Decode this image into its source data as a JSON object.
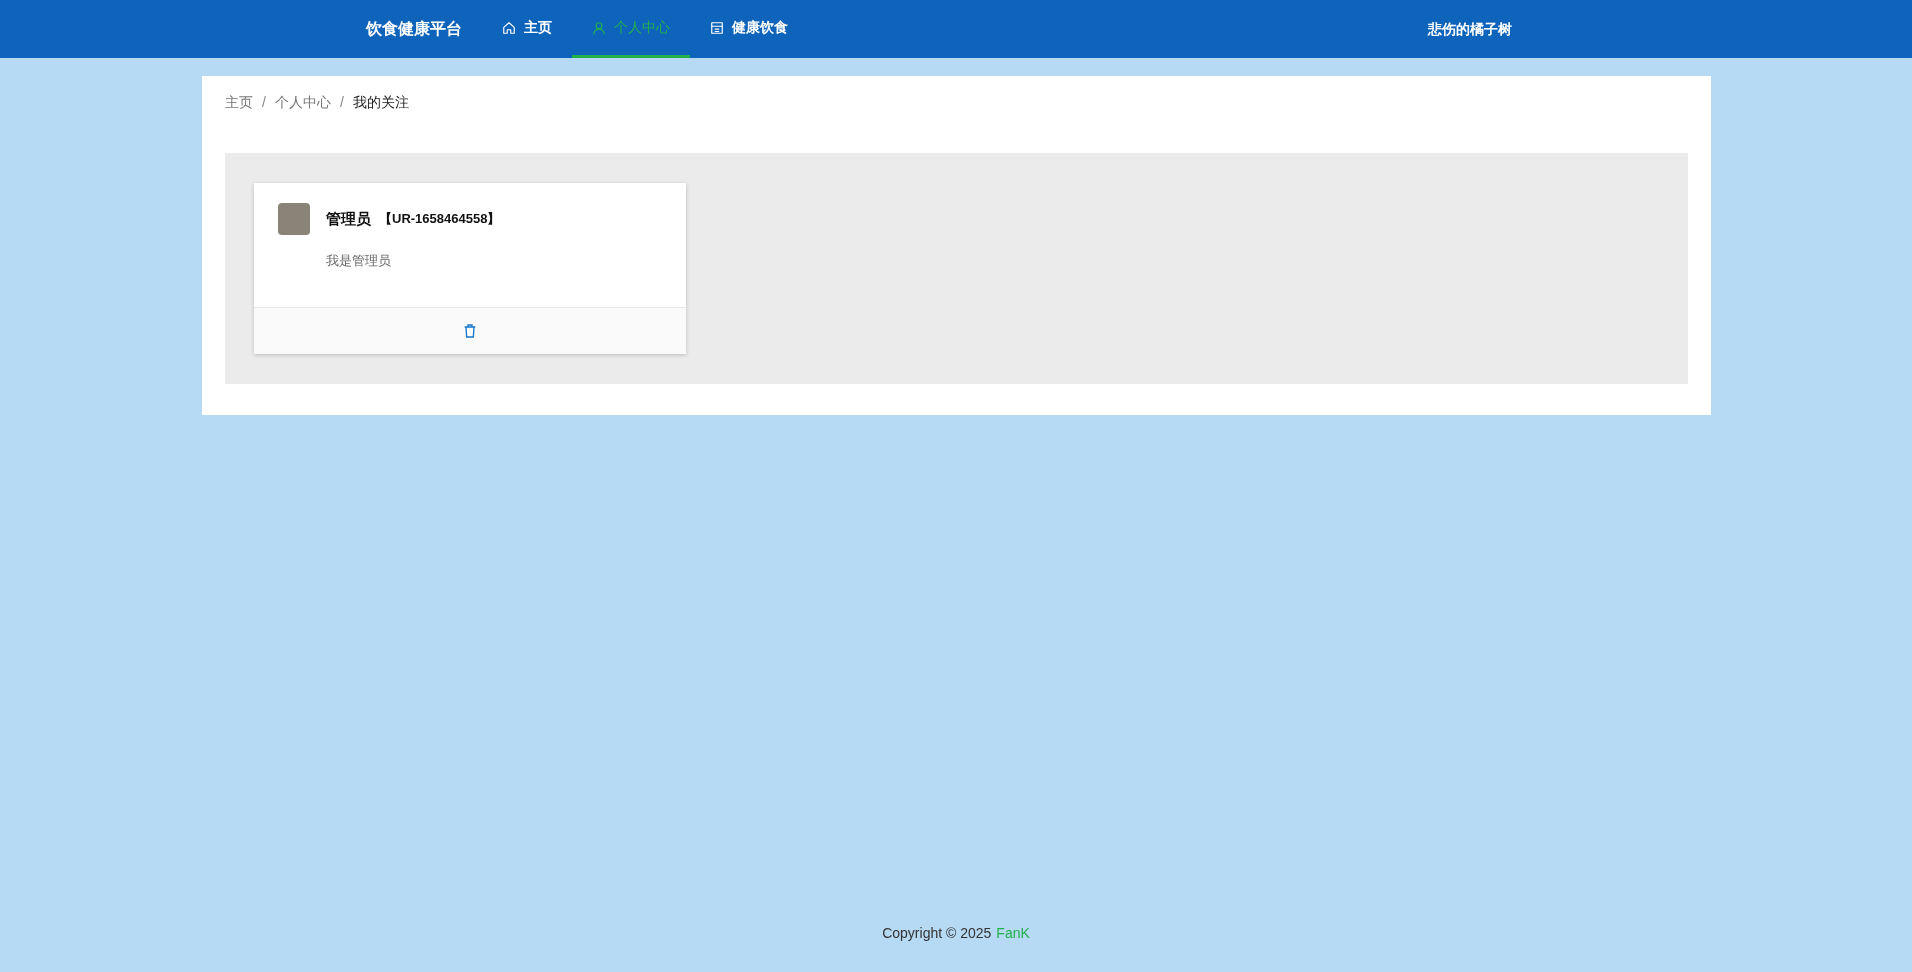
{
  "navbar": {
    "brand": "饮食健康平台",
    "items": [
      {
        "label": "主页",
        "selected": false
      },
      {
        "label": "个人中心",
        "selected": true
      },
      {
        "label": "健康饮食",
        "selected": false
      }
    ],
    "user": "悲伤的橘子树"
  },
  "breadcrumb": {
    "separator": "/",
    "items": [
      "主页",
      "个人中心",
      "我的关注"
    ]
  },
  "follows": [
    {
      "name": "管理员",
      "code": "【UR-1658464558】",
      "bio": "我是管理员"
    }
  ],
  "footer": {
    "text": "Copyright © 2025",
    "link": "FanK"
  }
}
